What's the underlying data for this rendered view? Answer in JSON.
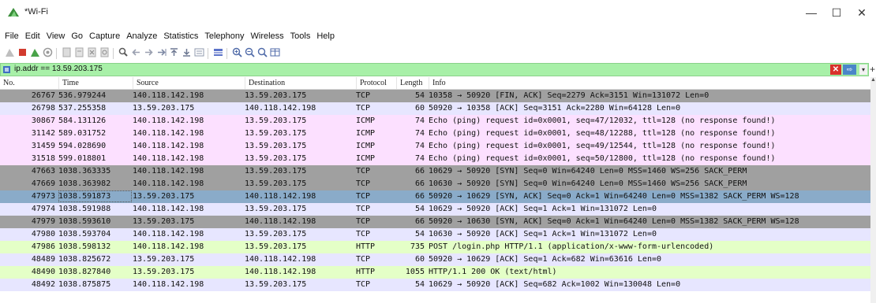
{
  "window": {
    "title": "*Wi-Fi",
    "controls": {
      "minimize": "—",
      "maximize": "☐",
      "close": "✕"
    }
  },
  "menu": [
    "File",
    "Edit",
    "View",
    "Go",
    "Capture",
    "Analyze",
    "Statistics",
    "Telephony",
    "Wireless",
    "Tools",
    "Help"
  ],
  "toolbar": {
    "icons": [
      "shark-fin-start-icon",
      "stop-icon",
      "restart-icon",
      "capture-options-icon",
      "open-file-icon",
      "save-file-icon",
      "close-file-icon",
      "reload-icon",
      "find-packet-icon",
      "go-back-icon",
      "go-forward-icon",
      "go-to-packet-icon",
      "go-first-icon",
      "go-last-icon",
      "autoscroll-icon",
      "colorize-icon",
      "zoom-in-icon",
      "zoom-out-icon",
      "normal-size-icon",
      "resize-columns-icon"
    ]
  },
  "filter": {
    "value": "ip.addr == 13.59.203.175",
    "clear_label": "✕",
    "apply_label": "⇨",
    "dropdown_label": "▾",
    "add_label": "+"
  },
  "columns": [
    "No.",
    "Time",
    "Source",
    "Destination",
    "Protocol",
    "Length",
    "Info"
  ],
  "colors": {
    "tcp_fin": "#a0a0a0",
    "tcp": "#e7e6ff",
    "icmp": "#fce0ff",
    "tcp_syn": "#a0a0a0",
    "selected": "#8aabc9",
    "http": "#e4ffc7",
    "filter_bg": "#a8f0a8"
  },
  "packets": [
    {
      "no": "26767",
      "time": "536.979244",
      "src": "140.118.142.198",
      "dst": "13.59.203.175",
      "proto": "TCP",
      "len": "54",
      "info": "10358 → 50920 [FIN, ACK] Seq=2279 Ack=3151 Win=131072 Len=0",
      "kind": "tcp_fin"
    },
    {
      "no": "26798",
      "time": "537.255358",
      "src": "13.59.203.175",
      "dst": "140.118.142.198",
      "proto": "TCP",
      "len": "60",
      "info": "50920 → 10358 [ACK] Seq=3151 Ack=2280 Win=64128 Len=0",
      "kind": "tcp"
    },
    {
      "no": "30867",
      "time": "584.131126",
      "src": "140.118.142.198",
      "dst": "13.59.203.175",
      "proto": "ICMP",
      "len": "74",
      "info": "Echo (ping) request  id=0x0001, seq=47/12032, ttl=128 (no response found!)",
      "kind": "icmp"
    },
    {
      "no": "31142",
      "time": "589.031752",
      "src": "140.118.142.198",
      "dst": "13.59.203.175",
      "proto": "ICMP",
      "len": "74",
      "info": "Echo (ping) request  id=0x0001, seq=48/12288, ttl=128 (no response found!)",
      "kind": "icmp"
    },
    {
      "no": "31459",
      "time": "594.028690",
      "src": "140.118.142.198",
      "dst": "13.59.203.175",
      "proto": "ICMP",
      "len": "74",
      "info": "Echo (ping) request  id=0x0001, seq=49/12544, ttl=128 (no response found!)",
      "kind": "icmp"
    },
    {
      "no": "31518",
      "time": "599.018801",
      "src": "140.118.142.198",
      "dst": "13.59.203.175",
      "proto": "ICMP",
      "len": "74",
      "info": "Echo (ping) request  id=0x0001, seq=50/12800, ttl=128 (no response found!)",
      "kind": "icmp"
    },
    {
      "no": "47663",
      "time": "1038.363335",
      "src": "140.118.142.198",
      "dst": "13.59.203.175",
      "proto": "TCP",
      "len": "66",
      "info": "10629 → 50920 [SYN] Seq=0 Win=64240 Len=0 MSS=1460 WS=256 SACK_PERM",
      "kind": "tcp_syn"
    },
    {
      "no": "47669",
      "time": "1038.363982",
      "src": "140.118.142.198",
      "dst": "13.59.203.175",
      "proto": "TCP",
      "len": "66",
      "info": "10630 → 50920 [SYN] Seq=0 Win=64240 Len=0 MSS=1460 WS=256 SACK_PERM",
      "kind": "tcp_syn"
    },
    {
      "no": "47973",
      "time": "1038.591873",
      "src": "13.59.203.175",
      "dst": "140.118.142.198",
      "proto": "TCP",
      "len": "66",
      "info": "50920 → 10629 [SYN, ACK] Seq=0 Ack=1 Win=64240 Len=0 MSS=1382 SACK_PERM WS=128",
      "kind": "selected"
    },
    {
      "no": "47974",
      "time": "1038.591988",
      "src": "140.118.142.198",
      "dst": "13.59.203.175",
      "proto": "TCP",
      "len": "54",
      "info": "10629 → 50920 [ACK] Seq=1 Ack=1 Win=131072 Len=0",
      "kind": "tcp"
    },
    {
      "no": "47979",
      "time": "1038.593610",
      "src": "13.59.203.175",
      "dst": "140.118.142.198",
      "proto": "TCP",
      "len": "66",
      "info": "50920 → 10630 [SYN, ACK] Seq=0 Ack=1 Win=64240 Len=0 MSS=1382 SACK_PERM WS=128",
      "kind": "tcp_syn"
    },
    {
      "no": "47980",
      "time": "1038.593704",
      "src": "140.118.142.198",
      "dst": "13.59.203.175",
      "proto": "TCP",
      "len": "54",
      "info": "10630 → 50920 [ACK] Seq=1 Ack=1 Win=131072 Len=0",
      "kind": "tcp"
    },
    {
      "no": "47986",
      "time": "1038.598132",
      "src": "140.118.142.198",
      "dst": "13.59.203.175",
      "proto": "HTTP",
      "len": "735",
      "info": "POST /login.php HTTP/1.1  (application/x-www-form-urlencoded)",
      "kind": "http"
    },
    {
      "no": "48489",
      "time": "1038.825672",
      "src": "13.59.203.175",
      "dst": "140.118.142.198",
      "proto": "TCP",
      "len": "60",
      "info": "50920 → 10629 [ACK] Seq=1 Ack=682 Win=63616 Len=0",
      "kind": "tcp"
    },
    {
      "no": "48490",
      "time": "1038.827840",
      "src": "13.59.203.175",
      "dst": "140.118.142.198",
      "proto": "HTTP",
      "len": "1055",
      "info": "HTTP/1.1 200 OK  (text/html)",
      "kind": "http"
    },
    {
      "no": "48492",
      "time": "1038.875875",
      "src": "140.118.142.198",
      "dst": "13.59.203.175",
      "proto": "TCP",
      "len": "54",
      "info": "10629 → 50920 [ACK] Seq=682 Ack=1002 Win=130048 Len=0",
      "kind": "tcp"
    }
  ]
}
